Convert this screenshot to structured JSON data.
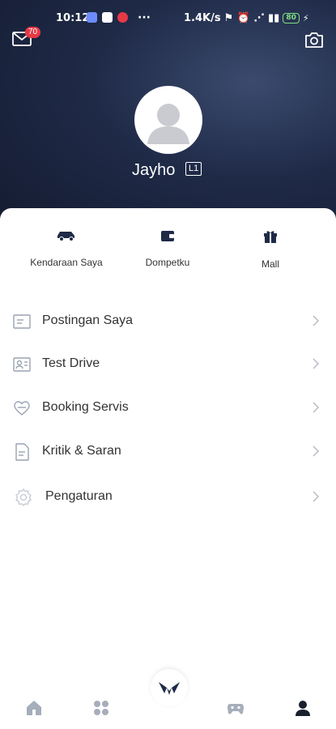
{
  "status": {
    "time": "10:12",
    "dots": "···",
    "net_speed": "1.4K/s",
    "battery": "80"
  },
  "header": {
    "message_badge": "70",
    "username": "Jayho",
    "level": "L1"
  },
  "quick_actions": [
    {
      "label": "Kendaraan Saya",
      "icon": "car-icon"
    },
    {
      "label": "Dompetku",
      "icon": "wallet-icon"
    },
    {
      "label": "Mall",
      "icon": "gift-icon"
    }
  ],
  "menu": [
    {
      "label": "Postingan Saya",
      "icon": "post-icon"
    },
    {
      "label": "Test Drive",
      "icon": "id-card-icon"
    },
    {
      "label": "Booking Servis",
      "icon": "service-icon"
    },
    {
      "label": "Kritik & Saran",
      "icon": "document-icon"
    },
    {
      "label": "Pengaturan",
      "icon": "settings-icon"
    }
  ],
  "bottom_nav": [
    {
      "name": "home-icon"
    },
    {
      "name": "apps-icon"
    },
    {
      "name": "brand-logo-icon"
    },
    {
      "name": "gamepad-icon"
    },
    {
      "name": "profile-icon"
    }
  ],
  "colors": {
    "header_dark": "#1f2a47",
    "icon_gray": "#9aa3b2",
    "active_nav": "#1a1f2e"
  }
}
